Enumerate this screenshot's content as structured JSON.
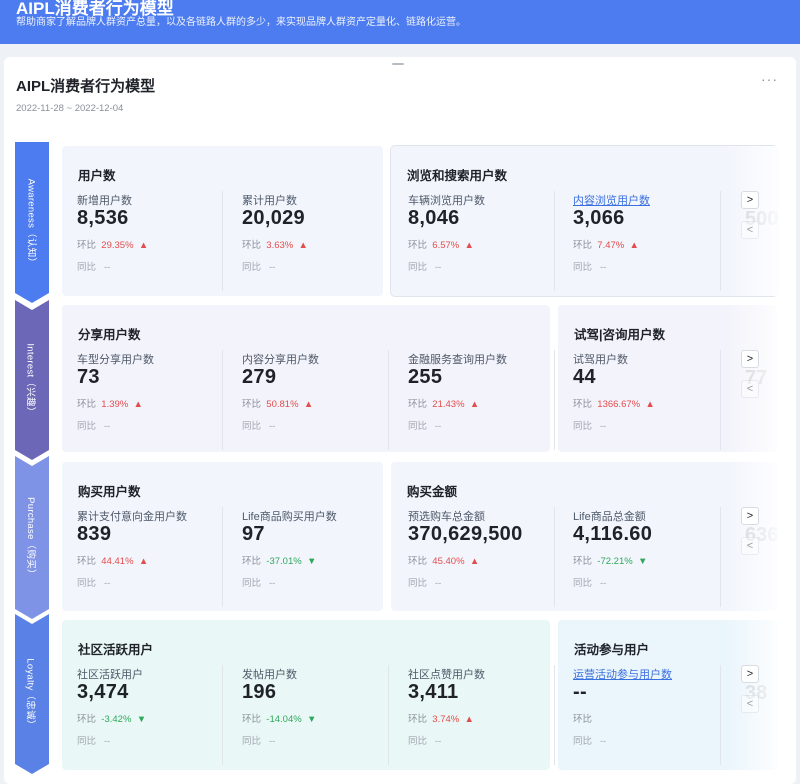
{
  "header": {
    "title": "AIPL消费者行为模型",
    "description": "帮助商家了解品牌人群资产总量，以及各链路人群的多少，来实现品牌人群资产定量化、链路化运营。"
  },
  "panel": {
    "title": "AIPL消费者行为模型",
    "date_range": "2022-11-28 ~ 2022-12-04",
    "more_icon": "···"
  },
  "common": {
    "ring_label": "环比",
    "yoy_label": "同比",
    "yoy_value": "--",
    "up_arrow": "🡅",
    "down_arrow": "🡇",
    "next": ">",
    "prev": "<"
  },
  "stages": [
    {
      "label": "Awareness（认知）",
      "color": "#4d7cf0"
    },
    {
      "label": "Interest（兴趣）",
      "color": "#6d67b8"
    },
    {
      "label": "Purchase（购买）",
      "color": "#7f93e6"
    },
    {
      "label": "Loyalty（忠诚）",
      "color": "#5a82e6"
    }
  ],
  "rows": [
    {
      "groups": [
        {
          "title": "用户数",
          "metrics": [
            {
              "label": "新增用户数",
              "value": "8,536",
              "ring": "29.35%",
              "trend": "up"
            },
            {
              "label": "累计用户数",
              "value": "20,029",
              "ring": "3.63%",
              "trend": "up"
            }
          ]
        },
        {
          "title": "浏览和搜索用户数",
          "metrics": [
            {
              "label": "车辆浏览用户数",
              "value": "8,046",
              "ring": "6.57%",
              "trend": "up"
            },
            {
              "label": "内容浏览用户数",
              "value": "3,066",
              "ring": "7.47%",
              "trend": "up",
              "link": true
            }
          ]
        }
      ],
      "ghost": "500"
    },
    {
      "groups": [
        {
          "title": "分享用户数",
          "metrics": [
            {
              "label": "车型分享用户数",
              "value": "73",
              "ring": "1.39%",
              "trend": "up"
            },
            {
              "label": "内容分享用户数",
              "value": "279",
              "ring": "50.81%",
              "trend": "up"
            },
            {
              "label": "金融服务查询用户数",
              "value": "255",
              "ring": "21.43%",
              "trend": "up"
            }
          ]
        },
        {
          "title": "试驾|咨询用户数",
          "metrics": [
            {
              "label": "试驾用户数",
              "value": "44",
              "ring": "1366.67%",
              "trend": "up"
            }
          ]
        }
      ],
      "ghost": "77"
    },
    {
      "groups": [
        {
          "title": "购买用户数",
          "metrics": [
            {
              "label": "累计支付意向金用户数",
              "value": "839",
              "ring": "44.41%",
              "trend": "up"
            },
            {
              "label": "Life商品购买用户数",
              "value": "97",
              "ring": "-37.01%",
              "trend": "down"
            }
          ]
        },
        {
          "title": "购买金额",
          "metrics": [
            {
              "label": "预选购车总金额",
              "value": "370,629,500",
              "ring": "45.40%",
              "trend": "up"
            },
            {
              "label": "Life商品总金额",
              "value": "4,116.60",
              "ring": "-72.21%",
              "trend": "down"
            }
          ]
        }
      ],
      "ghost": "636"
    },
    {
      "groups": [
        {
          "title": "社区活跃用户",
          "metrics": [
            {
              "label": "社区活跃用户",
              "value": "3,474",
              "ring": "-3.42%",
              "trend": "down"
            },
            {
              "label": "发帖用户数",
              "value": "196",
              "ring": "-14.04%",
              "trend": "down"
            },
            {
              "label": "社区点赞用户数",
              "value": "3,411",
              "ring": "3.74%",
              "trend": "up"
            }
          ]
        },
        {
          "title": "活动参与用户",
          "metrics": [
            {
              "label": "运营活动参与用户数",
              "value": "--",
              "ring": "",
              "trend": "",
              "link": true
            }
          ]
        }
      ],
      "ghost": "38"
    }
  ]
}
